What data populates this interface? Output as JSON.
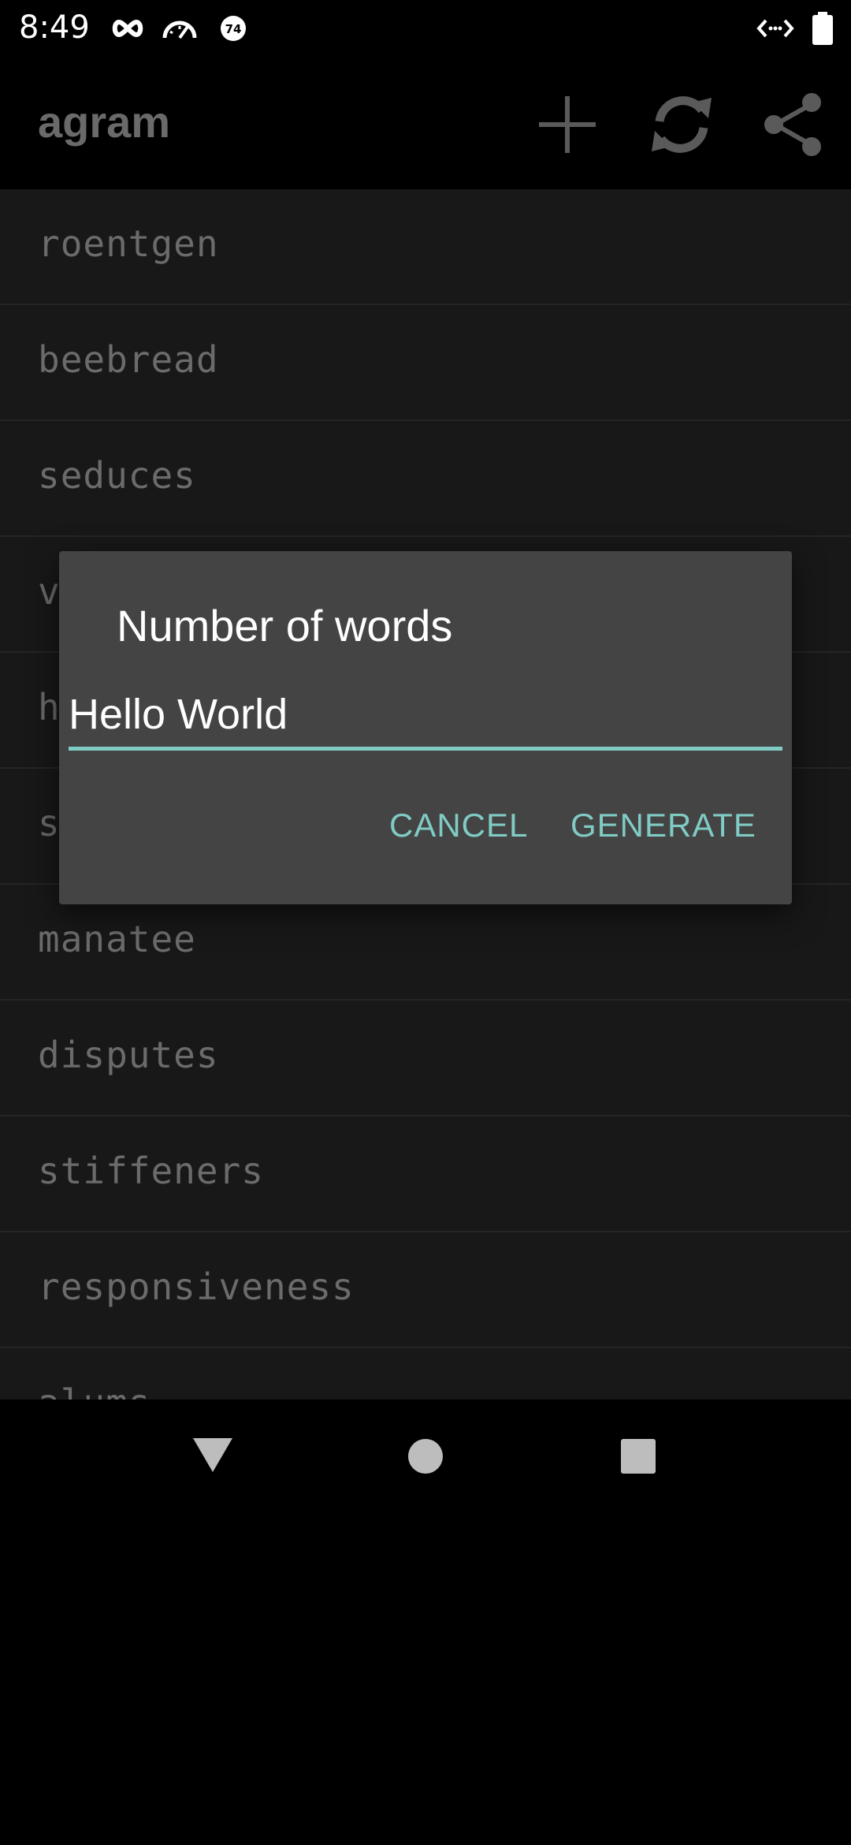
{
  "status_bar": {
    "time": "8:49",
    "notification_badge": "74",
    "icons": [
      "infinity-icon",
      "speedometer-icon",
      "badge-icon",
      "code-icon",
      "battery-icon"
    ]
  },
  "app_bar": {
    "title": "agram",
    "actions": [
      "add-icon",
      "refresh-icon",
      "share-icon"
    ]
  },
  "words": [
    "roentgen",
    "beebread",
    "seduces",
    "v",
    "h",
    "s",
    "manatee",
    "disputes",
    "stiffeners",
    "responsiveness",
    "alums"
  ],
  "dialog": {
    "title": "Number of words",
    "input_value": "Hello World",
    "cancel_label": "CANCEL",
    "generate_label": "GENERATE"
  },
  "nav_bar": {
    "icons": [
      "back-icon",
      "home-icon",
      "recents-icon"
    ]
  },
  "colors": {
    "accent": "#80cbc4",
    "dialog_bg": "#444444",
    "list_bg": "#181818",
    "list_text": "#6b6b6b"
  }
}
